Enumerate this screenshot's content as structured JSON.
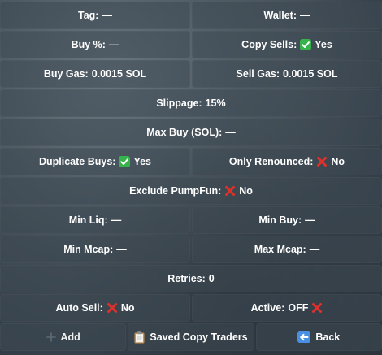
{
  "buttons": {
    "tag": {
      "label": "Tag:",
      "value": "—"
    },
    "wallet": {
      "label": "Wallet:",
      "value": "—"
    },
    "buy_pct": {
      "label": "Buy %:",
      "value": "—"
    },
    "copy_sells": {
      "label": "Copy Sells:",
      "value": "Yes",
      "icon": "check-icon"
    },
    "buy_gas": {
      "label": "Buy Gas:",
      "value": "0.0015 SOL"
    },
    "sell_gas": {
      "label": "Sell Gas:",
      "value": "0.0015 SOL"
    },
    "slippage": {
      "label": "Slippage:",
      "value": "15%"
    },
    "max_buy": {
      "label": "Max Buy (SOL):",
      "value": "—"
    },
    "duplicate_buys": {
      "label": "Duplicate Buys:",
      "value": "Yes",
      "icon": "check-icon"
    },
    "only_renounced": {
      "label": "Only Renounced:",
      "value": "No",
      "icon": "cross-icon"
    },
    "exclude_pumpfun": {
      "label": "Exclude PumpFun:",
      "value": "No",
      "icon": "cross-icon"
    },
    "min_liq": {
      "label": "Min Liq:",
      "value": "—"
    },
    "min_buy": {
      "label": "Min Buy:",
      "value": "—"
    },
    "min_mcap": {
      "label": "Min Mcap:",
      "value": "—"
    },
    "max_mcap": {
      "label": "Max Mcap:",
      "value": "—"
    },
    "retries": {
      "label": "Retries:",
      "value": "0"
    },
    "auto_sell": {
      "label": "Auto Sell:",
      "value": "No",
      "icon": "cross-icon"
    },
    "active": {
      "label": "Active:",
      "value": "OFF",
      "icon": "cross-icon"
    },
    "add": {
      "label": "Add",
      "icon": "plus-icon"
    },
    "saved_copy_traders": {
      "label": "Saved Copy Traders",
      "icon": "clipboard-icon"
    },
    "back": {
      "label": "Back",
      "icon": "back-arrow-icon"
    }
  },
  "colors": {
    "check": "#36b34a",
    "cross": "#e0302a",
    "back": "#4a90e2",
    "button_bg": "rgba(60,72,82,0.55)",
    "text": "#ffffff"
  }
}
